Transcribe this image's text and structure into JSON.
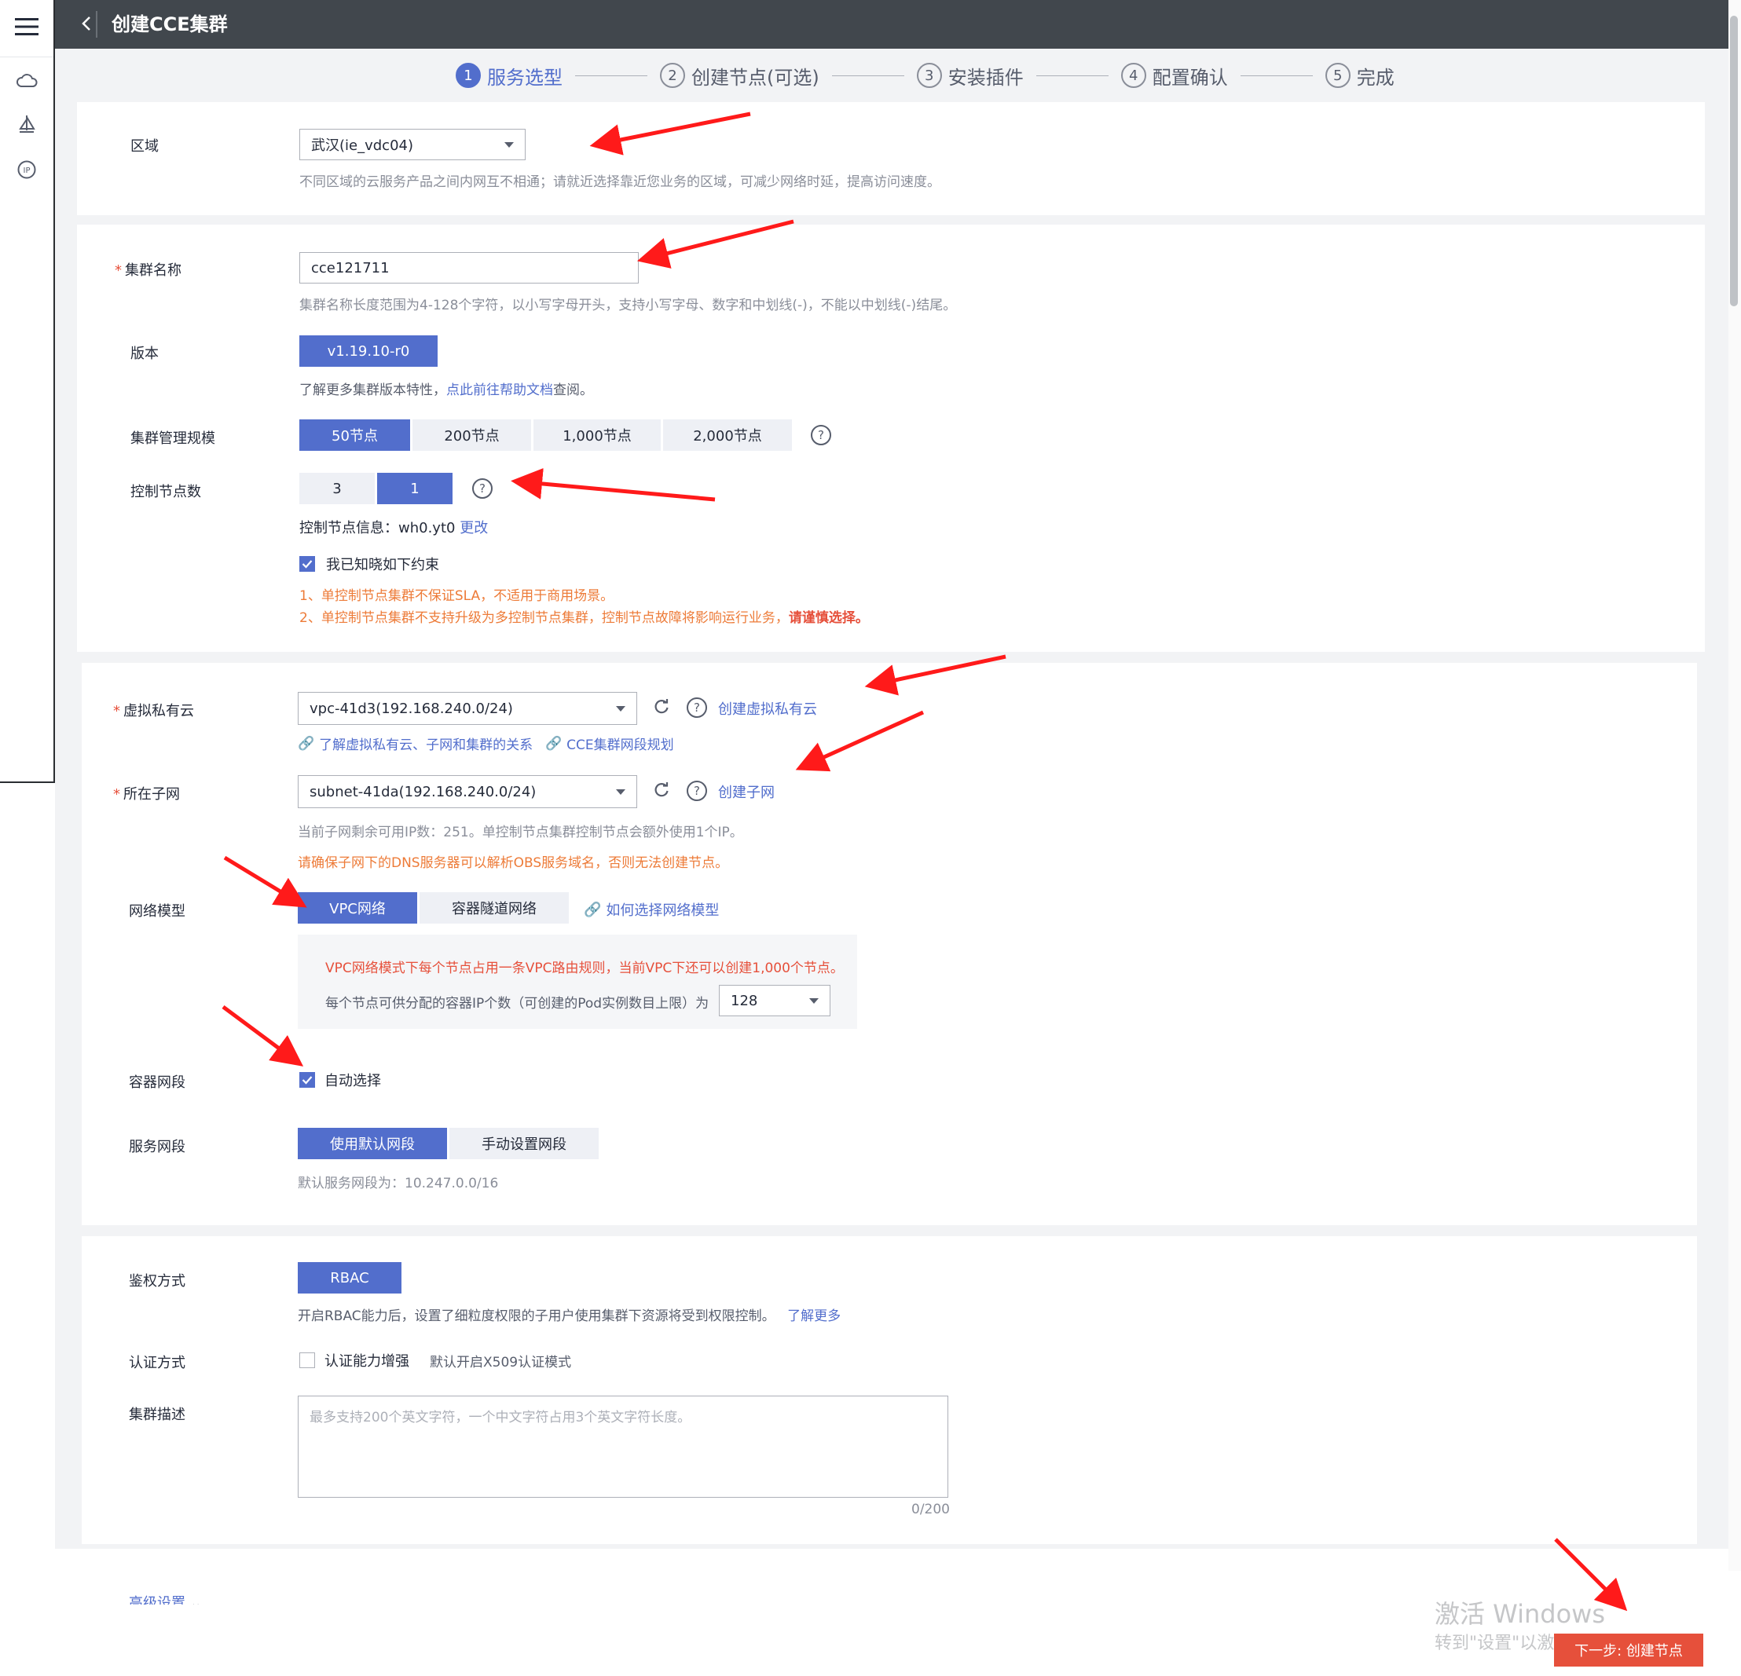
{
  "header": {
    "title": "创建CCE集群"
  },
  "sidebar": {
    "icons": [
      "menu-icon",
      "cloud-icon",
      "sailboat-icon",
      "ip-icon"
    ]
  },
  "steps": [
    {
      "num": "1",
      "label": "服务选型",
      "active": true
    },
    {
      "num": "2",
      "label": "创建节点(可选)"
    },
    {
      "num": "3",
      "label": "安装插件"
    },
    {
      "num": "4",
      "label": "配置确认"
    },
    {
      "num": "5",
      "label": "完成"
    }
  ],
  "region": {
    "label": "区域",
    "value": "武汉(ie_vdc04)",
    "hint": "不同区域的云服务产品之间内网互不相通；请就近选择靠近您业务的区域，可减少网络时延，提高访问速度。"
  },
  "cluster_name": {
    "label": "集群名称",
    "value": "cce121711",
    "hint": "集群名称长度范围为4-128个字符，以小写字母开头，支持小写字母、数字和中划线(-)，不能以中划线(-)结尾。"
  },
  "version": {
    "label": "版本",
    "value": "v1.19.10-r0",
    "hint_prefix": "了解更多集群版本特性，",
    "hint_link": "点此前往帮助文档",
    "hint_suffix": "查阅。"
  },
  "scale": {
    "label": "集群管理规模",
    "options": [
      "50节点",
      "200节点",
      "1,000节点",
      "2,000节点"
    ],
    "selected": "50节点"
  },
  "masters": {
    "label": "控制节点数",
    "options": [
      "3",
      "1"
    ],
    "selected": "1",
    "info_label": "控制节点信息：",
    "info_value": "wh0.yt0",
    "info_link": "更改",
    "ack_label": "我已知晓如下约束",
    "warning1": "1、单控制节点集群不保证SLA，不适用于商用场景。",
    "warning2": "2、单控制节点集群不支持升级为多控制节点集群，控制节点故障将影响运行业务，",
    "warning2_strong": "请谨慎选择。"
  },
  "vpc": {
    "label": "虚拟私有云",
    "value": "vpc-41d3(192.168.240.0/24)",
    "create_link": "创建虚拟私有云",
    "link1": "了解虚拟私有云、子网和集群的关系",
    "link2": "CCE集群网段规划"
  },
  "subnet": {
    "label": "所在子网",
    "value": "subnet-41da(192.168.240.0/24)",
    "create_link": "创建子网",
    "hint": "当前子网剩余可用IP数：251。单控制节点集群控制节点会额外使用1个IP。",
    "warning": "请确保子网下的DNS服务器可以解析OBS服务域名，否则无法创建节点。"
  },
  "network_model": {
    "label": "网络模型",
    "options": [
      "VPC网络",
      "容器隧道网络"
    ],
    "selected": "VPC网络",
    "help_link": "如何选择网络模型",
    "box_warning": "VPC网络模式下每个节点占用一条VPC路由规则，当前VPC下还可以创建1,000个节点。",
    "box_text": "每个节点可供分配的容器IP个数（可创建的Pod实例数目上限）为",
    "box_value": "128"
  },
  "container_cidr": {
    "label": "容器网段",
    "auto_label": "自动选择"
  },
  "service_cidr": {
    "label": "服务网段",
    "options": [
      "使用默认网段",
      "手动设置网段"
    ],
    "selected": "使用默认网段",
    "hint": "默认服务网段为：10.247.0.0/16"
  },
  "auth_mode": {
    "label": "鉴权方式",
    "value": "RBAC",
    "hint": "开启RBAC能力后，设置了细粒度权限的子用户使用集群下资源将受到权限控制。",
    "link": "了解更多"
  },
  "authn": {
    "label": "认证方式",
    "checkbox_label": "认证能力增强",
    "hint": "默认开启X509认证模式"
  },
  "description": {
    "label": "集群描述",
    "placeholder": "最多支持200个英文字符，一个中文字符占用3个英文字符长度。",
    "counter": "0/200"
  },
  "advanced": {
    "label": "高级设置"
  },
  "watermark": {
    "line1": "激活 Windows",
    "line2": "转到\"设置\"以激活 Windows。"
  },
  "footer": {
    "next_button": "下一步: 创建节点"
  },
  "colors": {
    "primary": "#526ecc",
    "danger": "#e6503b",
    "warning": "#ed7b38",
    "header": "#41474d"
  }
}
